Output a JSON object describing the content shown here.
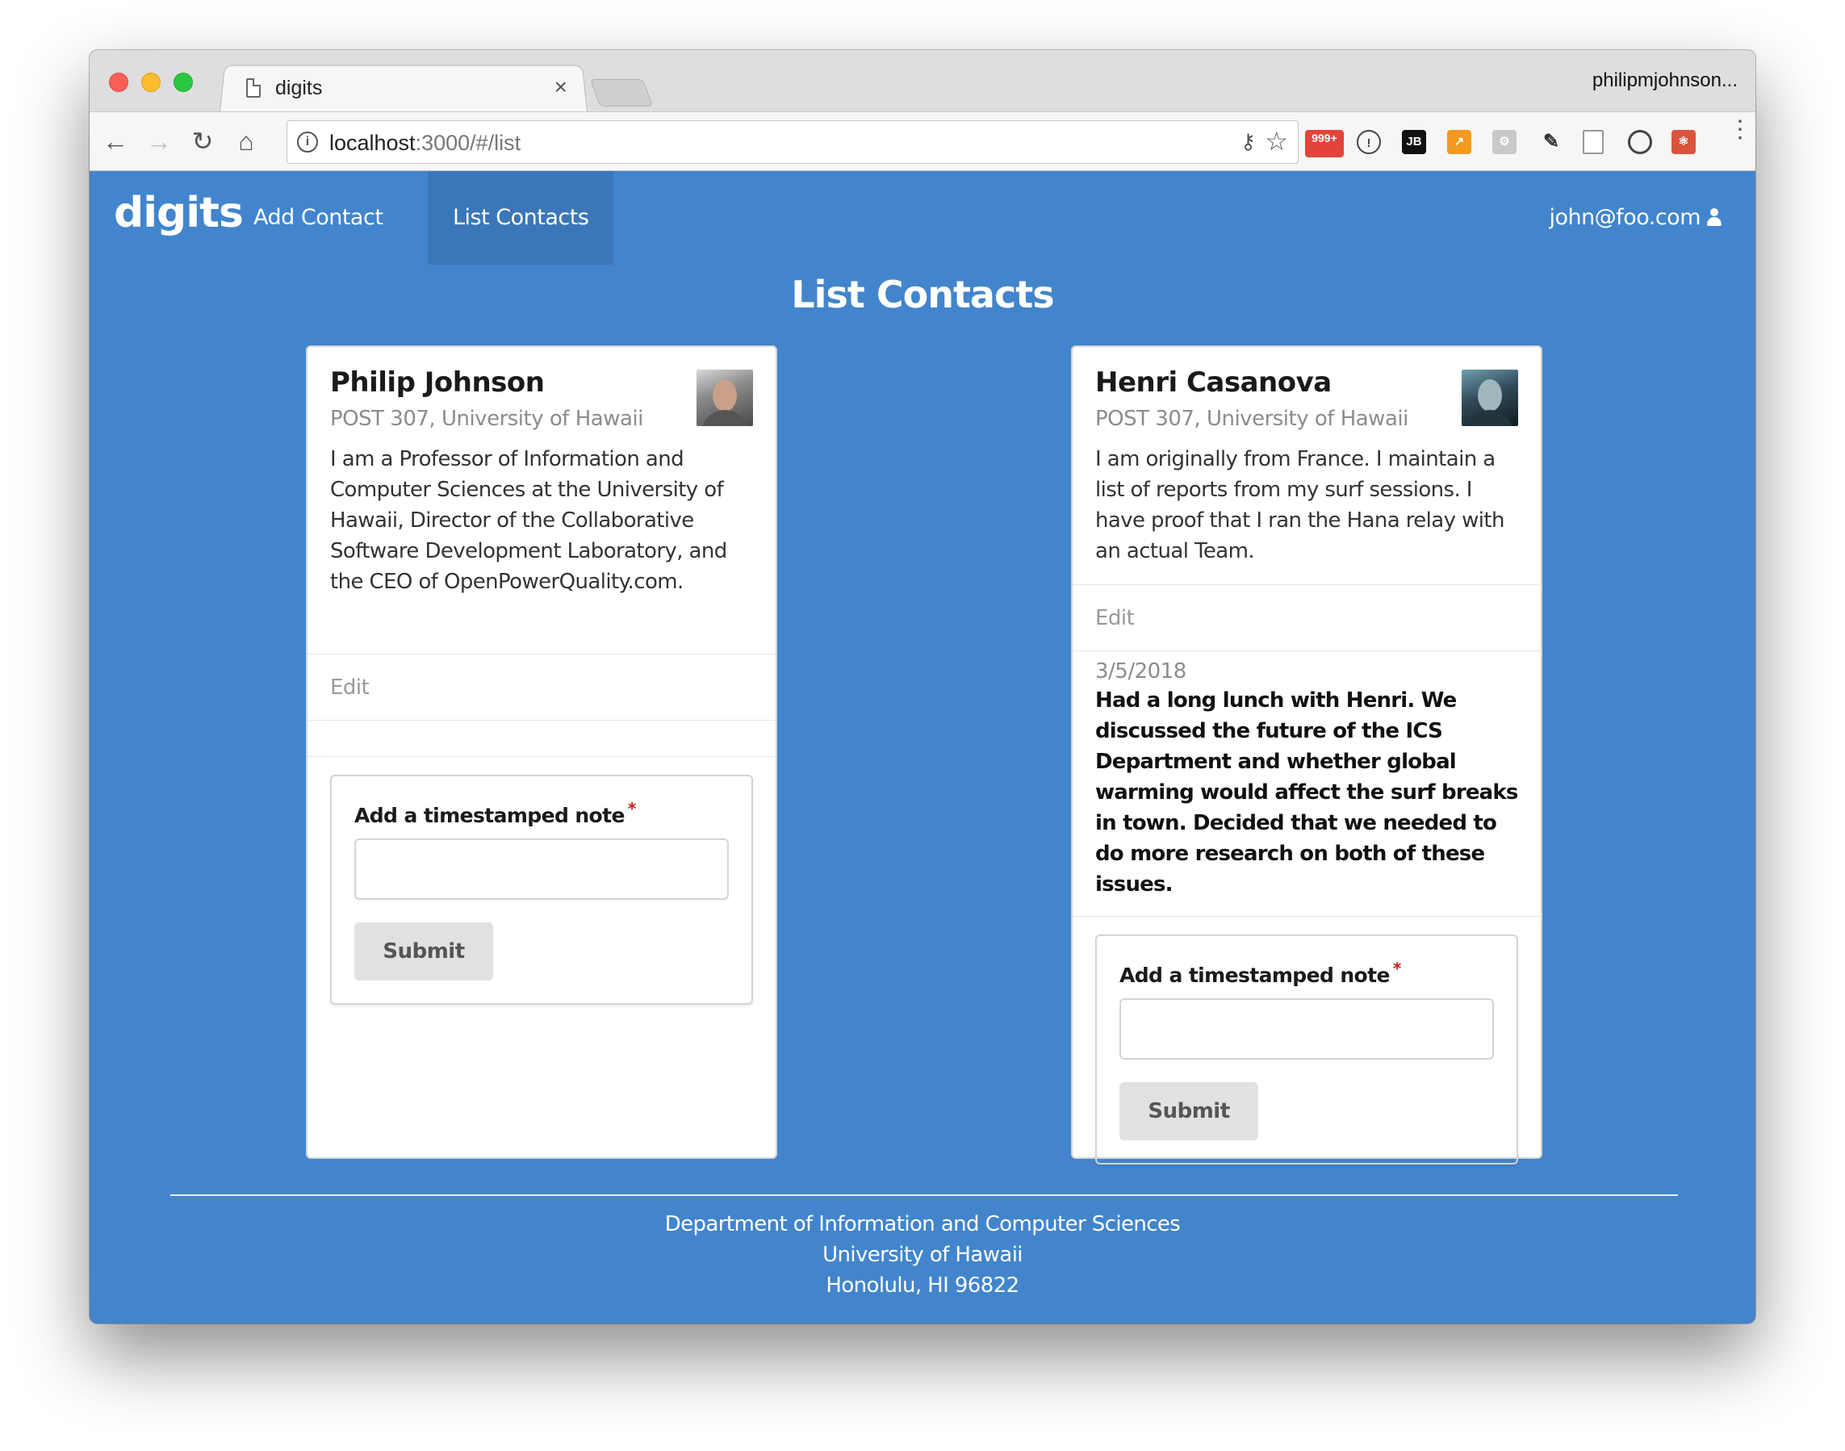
{
  "browser": {
    "tab_title": "digits",
    "tab_close": "×",
    "profile_name": "philipmjohnson...",
    "url_host": "localhost",
    "url_rest": ":3000/#/list",
    "ext_badge": "999+",
    "ext_jb": "JB",
    "icons": [
      "back-icon",
      "forward-icon",
      "reload-icon",
      "home-icon",
      "info-icon",
      "key-icon",
      "star-icon",
      "menu-icon"
    ]
  },
  "nav": {
    "brand": "digits",
    "items": [
      {
        "label": "Add Contact"
      },
      {
        "label": "List Contacts"
      }
    ],
    "user": "john@foo.com"
  },
  "page": {
    "title": "List Contacts"
  },
  "contacts": [
    {
      "name": "Philip Johnson",
      "address": "POST 307, University of Hawaii",
      "description": "I am a Professor of Information and Computer Sciences at the University of Hawaii, Director of the Collaborative Software Development Laboratory, and the CEO of OpenPowerQuality.com.",
      "edit": "Edit",
      "notes": [],
      "form_label": "Add a timestamped note",
      "required_mark": "*",
      "submit": "Submit"
    },
    {
      "name": "Henri Casanova",
      "address": "POST 307, University of Hawaii",
      "description": "I am originally from France. I maintain a list of reports from my surf sessions. I have proof that I ran the Hana relay with an actual Team.",
      "edit": "Edit",
      "notes": [
        {
          "date": "3/5/2018",
          "text": "Had a long lunch with Henri. We discussed the future of the ICS Department and whether global warming would affect the surf breaks in town. Decided that we needed to do more research on both of these issues."
        }
      ],
      "form_label": "Add a timestamped note",
      "required_mark": "*",
      "submit": "Submit"
    }
  ],
  "footer": {
    "line1": "Department of Information and Computer Sciences",
    "line2": "University of Hawaii",
    "line3": "Honolulu, HI 96822"
  },
  "colors": {
    "page_bg": "#4285cc",
    "active_nav": "#3b77b8",
    "required": "#d01919"
  }
}
